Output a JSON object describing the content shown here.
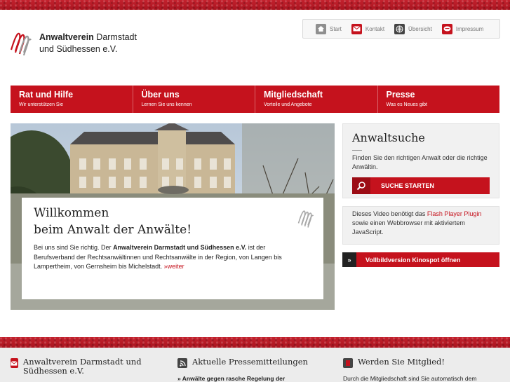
{
  "logo": {
    "line1_bold": "Anwaltverein",
    "line1_rest": " Darmstadt",
    "line2": "und Südhessen e.V."
  },
  "toplinks": [
    {
      "label": "Start",
      "icon": "home-icon",
      "color": "#8f8f8f"
    },
    {
      "label": "Kontakt",
      "icon": "mail-icon",
      "color": "#c5121d"
    },
    {
      "label": "Übersicht",
      "icon": "globe-icon",
      "color": "#444444"
    },
    {
      "label": "Impressum",
      "icon": "speech-icon",
      "color": "#c5121d"
    }
  ],
  "mainnav": [
    {
      "title": "Rat und Hilfe",
      "subtitle": "Wir unterstützen Sie"
    },
    {
      "title": "Über uns",
      "subtitle": "Lernen Sie uns kennen"
    },
    {
      "title": "Mitgliedschaft",
      "subtitle": "Vorteile und Angebote"
    },
    {
      "title": "Presse",
      "subtitle": "Was es Neues gibt"
    }
  ],
  "welcome": {
    "title_line1": "Willkommen",
    "title_line2": "beim Anwalt der Anwälte!",
    "text_before": "Bei uns sind Sie richtig. Der ",
    "text_bold": "Anwaltverein Darmstadt und Südhessen e.V.",
    "text_after": " ist der Berufsverband der Rechtsanwältinnen und Rechtsanwälte in der Region, von Langen bis Lampertheim, von Gernsheim bis Michelstadt. ",
    "more": "»weiter"
  },
  "anwaltsuche": {
    "title": "Anwaltsuche",
    "text": "Finden Sie den richtigen Anwalt oder die richtige Anwältin.",
    "button": "SUCHE STARTEN"
  },
  "flash": {
    "text_before": "Dieses Video benötigt das ",
    "link": "Flash Player Plugin",
    "text_after": " sowie einen Webbrowser mit aktiviertem JavaScript."
  },
  "kino": {
    "icon_glyph": "»",
    "label": "Vollbildversion Kinospot öffnen"
  },
  "footer": [
    {
      "icon": "mail-icon",
      "title": "Anwaltverein Darmstadt und Südhessen e.V.",
      "sub": ""
    },
    {
      "icon": "rss-icon",
      "title": "Aktuelle Pressemitteilungen",
      "sub": "» Anwälte gegen rasche Regelung der"
    },
    {
      "icon": "member-icon",
      "title": "Werden Sie Mitglied!",
      "sub": "Durch die Mitgliedschaft sind Sie automatisch dem"
    }
  ],
  "colors": {
    "brand_red": "#c5121d",
    "dark_red": "#9c0c15",
    "sidebar_bg": "#f1f1f1"
  }
}
